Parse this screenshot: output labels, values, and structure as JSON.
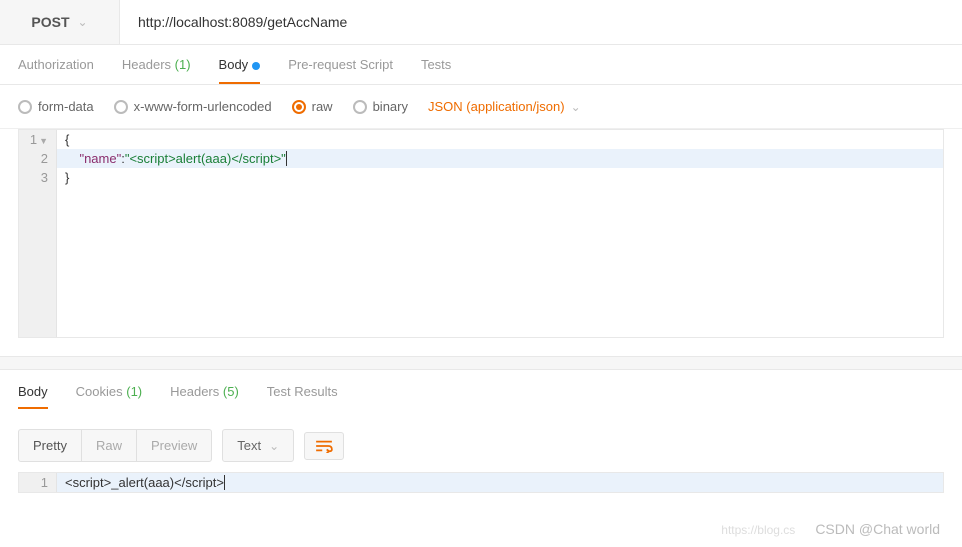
{
  "request": {
    "method": "POST",
    "url": "http://localhost:8089/getAccName"
  },
  "tabs": {
    "authorization": "Authorization",
    "headers": "Headers",
    "headers_count": "(1)",
    "body": "Body",
    "prerequest": "Pre-request Script",
    "tests": "Tests"
  },
  "body_types": {
    "form_data": "form-data",
    "urlencoded": "x-www-form-urlencoded",
    "raw": "raw",
    "binary": "binary",
    "content_type": "JSON (application/json)"
  },
  "editor": {
    "line1_num": "1",
    "line2_num": "2",
    "line3_num": "3",
    "open_brace": "{",
    "indent": "    ",
    "key": "\"name\"",
    "colon": ":",
    "value": "\"<script>alert(aaa)</script>\"",
    "close_brace": "}"
  },
  "response": {
    "tabs": {
      "body": "Body",
      "cookies": "Cookies",
      "cookies_count": "(1)",
      "headers": "Headers",
      "headers_count": "(5)",
      "test_results": "Test Results"
    },
    "view": {
      "pretty": "Pretty",
      "raw": "Raw",
      "preview": "Preview",
      "format": "Text"
    },
    "line1_num": "1",
    "line1": "<script>_alert(aaa)</script>"
  },
  "watermark": {
    "light": "https://blog.cs",
    "main": "CSDN @Chat world"
  }
}
